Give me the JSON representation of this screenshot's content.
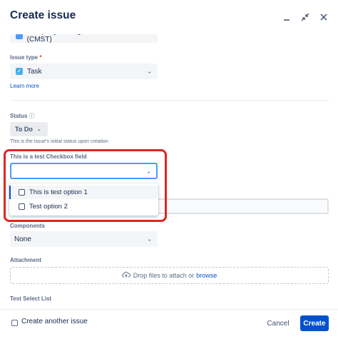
{
  "dialog": {
    "title": "Create issue",
    "icons": [
      "minimize-icon",
      "collapse-icon",
      "close-icon"
    ]
  },
  "project": {
    "value": "Company Managed Subtasks Test (CMST)"
  },
  "issue_type": {
    "label": "Issue type",
    "required_marker": "*",
    "value": "Task",
    "learn_more": "Learn more"
  },
  "status": {
    "label": "Status",
    "info_glyph": "ⓘ",
    "value": "To Do",
    "help": "This is the issue's initial status upon creation"
  },
  "checkbox_field": {
    "label": "This is a test Checkbox field",
    "value": "",
    "options": [
      {
        "label": "This is test option 1",
        "checked": false,
        "focused": true
      },
      {
        "label": "Test option 2",
        "checked": false,
        "focused": false
      }
    ]
  },
  "components": {
    "label": "Components",
    "value": "None"
  },
  "attachment": {
    "label": "Attachment",
    "drop_text": "Drop files to attach or",
    "browse": "browse"
  },
  "test_select": {
    "label": "Test Select List"
  },
  "footer": {
    "create_another": "Create another issue",
    "cancel": "Cancel",
    "create": "Create"
  },
  "colors": {
    "primary": "#0052cc",
    "highlight": "#e0261f",
    "focus_border": "#4c9aff"
  }
}
